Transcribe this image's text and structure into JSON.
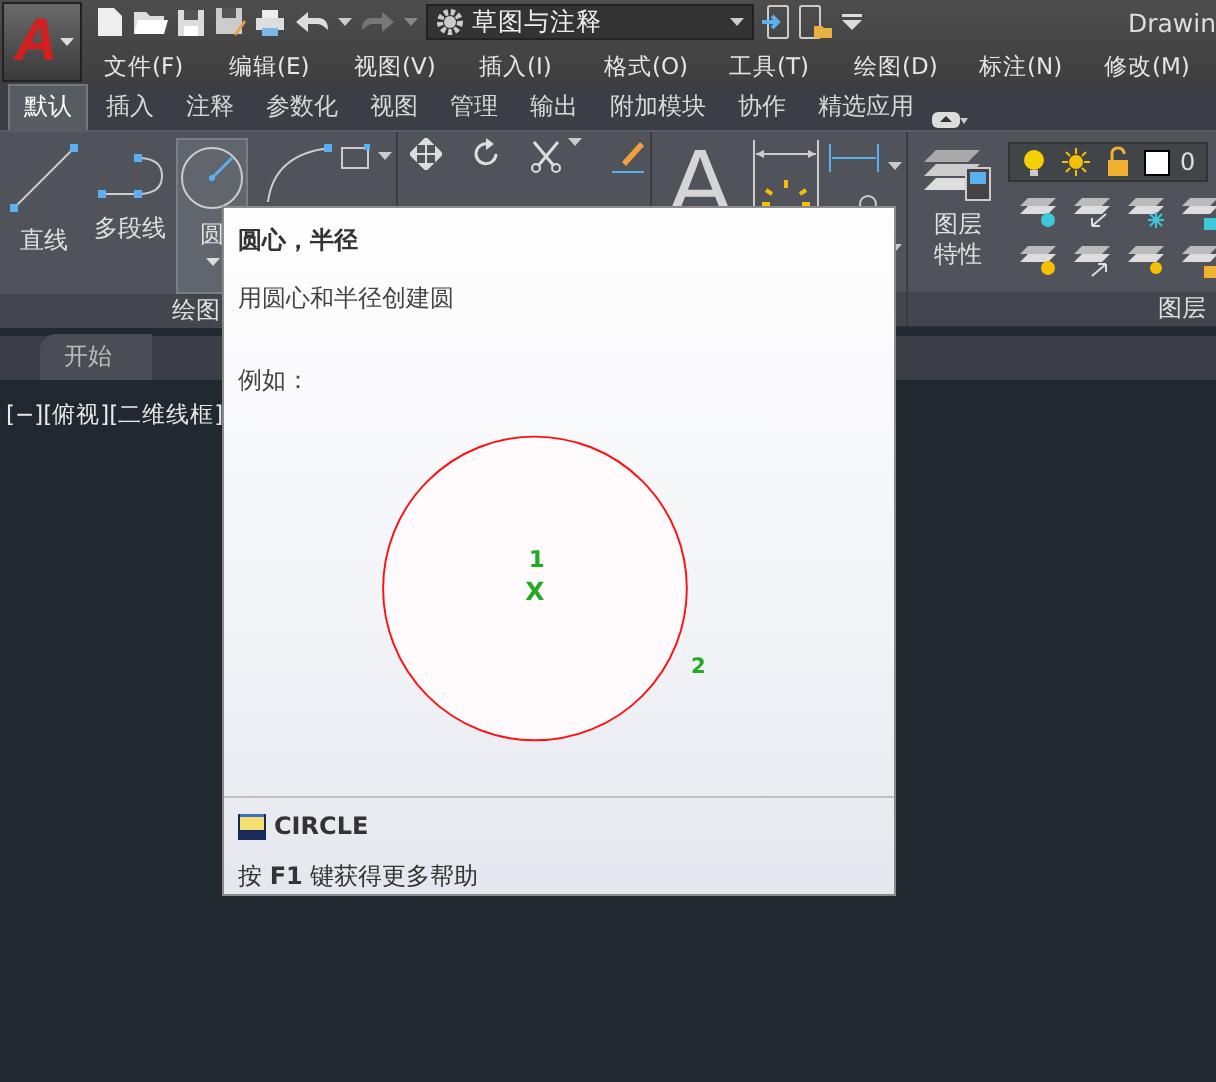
{
  "app_button": {
    "logo": "A"
  },
  "workspace": {
    "value": "草图与注释"
  },
  "title": "Drawin",
  "menus": [
    "文件(F)",
    "编辑(E)",
    "视图(V)",
    "插入(I)",
    "格式(O)",
    "工具(T)",
    "绘图(D)",
    "标注(N)",
    "修改(M)"
  ],
  "ribbon_tabs": [
    {
      "label": "默认",
      "selected": true
    },
    {
      "label": "插入",
      "selected": false
    },
    {
      "label": "注释",
      "selected": false
    },
    {
      "label": "参数化",
      "selected": false
    },
    {
      "label": "视图",
      "selected": false
    },
    {
      "label": "管理",
      "selected": false
    },
    {
      "label": "输出",
      "selected": false
    },
    {
      "label": "附加模块",
      "selected": false
    },
    {
      "label": "协作",
      "selected": false
    },
    {
      "label": "精选应用",
      "selected": false
    }
  ],
  "ribbon": {
    "draw_tools": [
      {
        "kind": "line",
        "label": "直线",
        "hovered": false
      },
      {
        "kind": "polyline",
        "label": "多段线",
        "hovered": false
      },
      {
        "kind": "circle",
        "label": "圆",
        "hovered": true
      }
    ],
    "text_tool": {
      "glyph": "A"
    },
    "layer_properties": {
      "label": "图层特性"
    },
    "current_layer": {
      "value": "0"
    },
    "panels": [
      {
        "title": "绘图"
      },
      {
        "title": "图层"
      }
    ]
  },
  "file_tabs": [
    {
      "label": "开始",
      "selected": true
    }
  ],
  "viewport": {
    "label": "[−][俯视][二维线框]"
  },
  "tooltip": {
    "title": "圆心，半径",
    "description": "用圆心和半径创建圆",
    "example_label": "例如：",
    "example_points": [
      "1",
      "X",
      "2"
    ],
    "command": "CIRCLE",
    "help": "按 **F1** 键获得更多帮助"
  }
}
